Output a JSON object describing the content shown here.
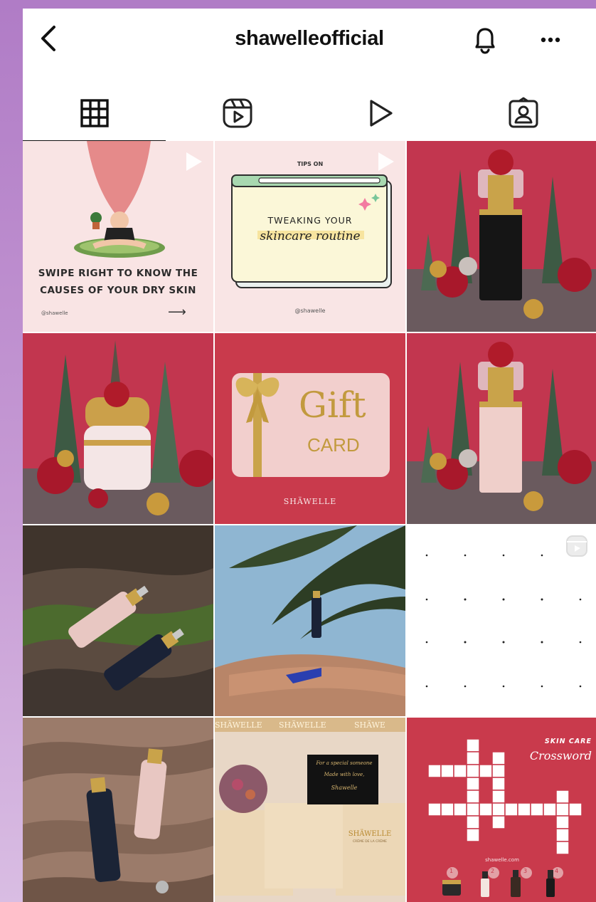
{
  "header": {
    "username": "shawelleofficial",
    "icons": {
      "back": "chevron-left-icon",
      "bell": "bell-icon",
      "more": "more-dots-icon"
    }
  },
  "tabs": [
    {
      "name": "tab-posts",
      "icon": "grid-icon",
      "active": true
    },
    {
      "name": "tab-reels",
      "icon": "reels-icon",
      "active": false
    },
    {
      "name": "tab-videos",
      "icon": "play-icon",
      "active": false
    },
    {
      "name": "tab-tagged",
      "icon": "tagged-person-icon",
      "active": false
    }
  ],
  "posts": {
    "p1": {
      "headline_line1": "SWIPE RIGHT TO KNOW THE",
      "headline_line2": "CAUSES OF YOUR DRY SKIN",
      "handle": "@shawelle",
      "arrow": "⟶"
    },
    "p2": {
      "kicker": "TIPS ON",
      "line1": "TWEAKING YOUR",
      "line2": "skincare routine",
      "handle": "@shawelle"
    },
    "p5": {
      "word1": "Gift",
      "word2": "CARD",
      "brand": "SHÄWELLE"
    },
    "p11": {
      "banner1": "SHÄWELLE",
      "banner2": "SHÄWELLE",
      "banner3": "SHÄWE",
      "note_line1": "For a special someone",
      "note_line2": "Made with love,",
      "note_line3": "Shawelle",
      "box_brand": "SHÄWELLE",
      "box_sub": "CRÈME DE LA CRÈME"
    },
    "p12": {
      "title_line1": "SKIN CARE",
      "title_line2": "Crossword",
      "site": "shawelle.com",
      "numbers": [
        "1",
        "2",
        "3",
        "4"
      ]
    }
  }
}
